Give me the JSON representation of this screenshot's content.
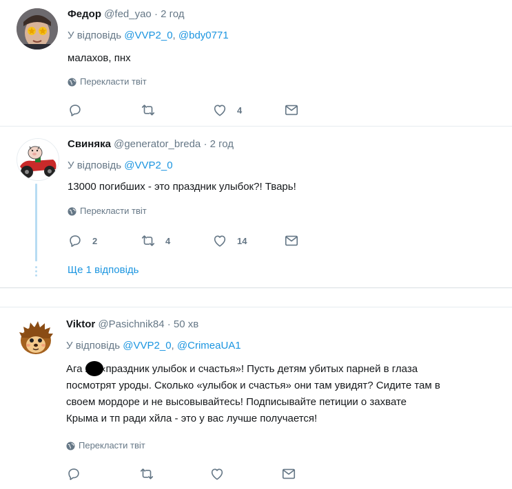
{
  "tweets": [
    {
      "name": "Федор",
      "handle": "@fed_yao",
      "time": "· 2 год",
      "reply_prefix": "У відповідь",
      "reply_to": [
        "@VVP2_0",
        "@bdy0771"
      ],
      "text": [
        "малахов, пнх"
      ],
      "translate": "Перекласти твіт",
      "counts": {
        "reply": "",
        "retweet": "",
        "like": "4"
      }
    },
    {
      "name": "Свиняка",
      "handle": "@generator_breda",
      "time": "· 2 год",
      "reply_prefix": "У відповідь",
      "reply_to": [
        "@VVP2_0"
      ],
      "text": [
        "13000 погибших - это праздник улыбок?! Тварь!"
      ],
      "translate": "Перекласти твіт",
      "counts": {
        "reply": "2",
        "retweet": "4",
        "like": "14"
      },
      "more_replies": "Ще 1 відповідь"
    },
    {
      "name": "Viktor",
      "handle": "@Pasichnik84",
      "time": "· 50 хв",
      "reply_prefix": "У відповідь",
      "reply_to": [
        "@VVP2_0",
        "@CrimeaUA1"
      ],
      "text": [
        "Ага    я - «праздник улыбок и счастья»! Пусть детям убитых парней в глаза",
        "посмотрят уроды. Сколько «улыбок и счастья» они там увидят? Сидите там в",
        "своем мордоре и не высовывайтесь! Подписывайте петиции о захвате",
        "Крыма и тп ради хйла - это у вас лучше получается!"
      ],
      "translate": "Перекласти твіт",
      "counts": {
        "reply": "",
        "retweet": "",
        "like": ""
      }
    }
  ],
  "icons": {
    "reply": "reply-icon",
    "retweet": "retweet-icon",
    "like": "heart-icon",
    "message": "envelope-icon",
    "translate": "globe-icon"
  },
  "colors": {
    "link": "#1b95e0",
    "muted": "#657786",
    "text": "#14171a",
    "thread_line": "#b7dcf3",
    "divider": "#e6ecf0"
  }
}
